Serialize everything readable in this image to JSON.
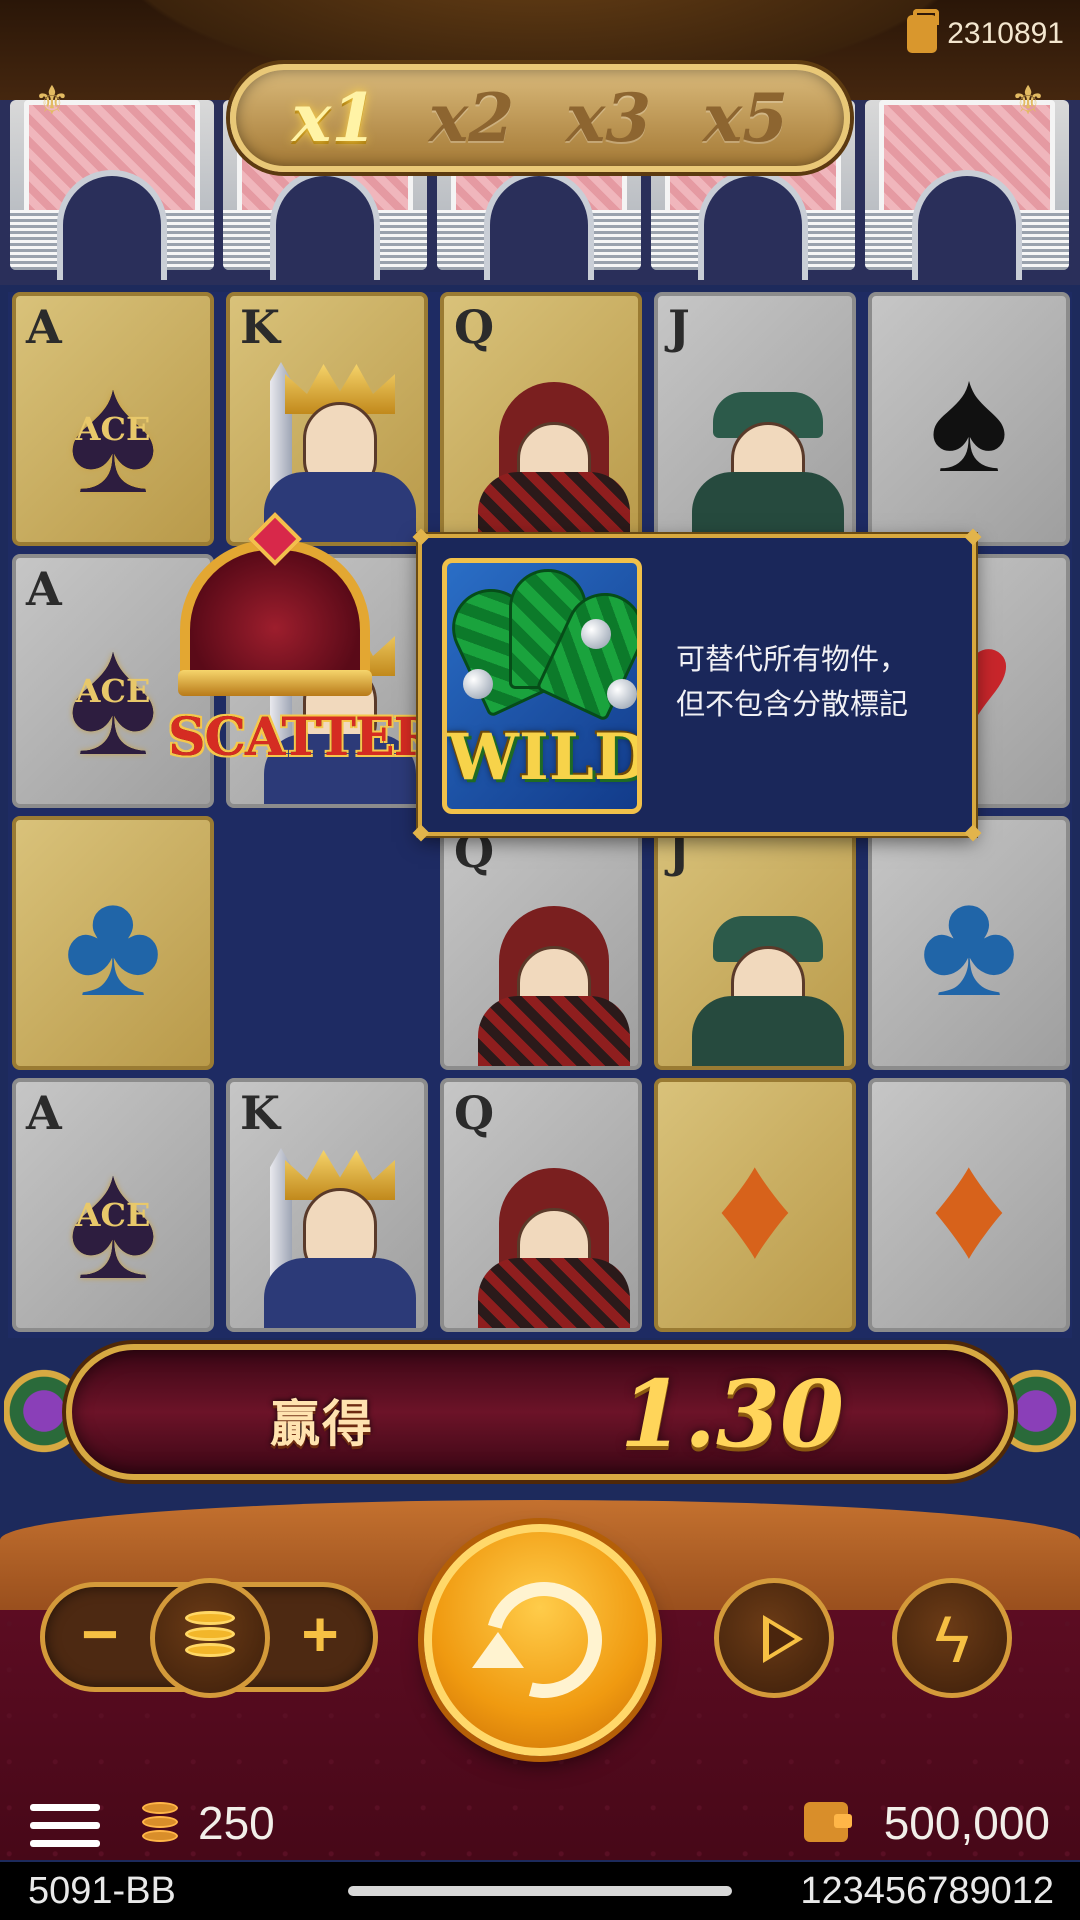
{
  "header": {
    "balance_top": "2310891",
    "multipliers": [
      {
        "label": "x1",
        "active": true
      },
      {
        "label": "x2",
        "active": false
      },
      {
        "label": "x3",
        "active": false
      },
      {
        "label": "x5",
        "active": false
      }
    ]
  },
  "grid": {
    "rows": [
      [
        {
          "rank": "A",
          "style": "gold",
          "symbol": "ace-spade-emblem",
          "emblem_text": "ACE"
        },
        {
          "rank": "K",
          "style": "gold",
          "symbol": "king"
        },
        {
          "rank": "Q",
          "style": "gold",
          "symbol": "queen"
        },
        {
          "rank": "J",
          "style": "silver",
          "symbol": "jack"
        },
        {
          "rank": "",
          "style": "silver",
          "symbol": "spade"
        }
      ],
      [
        {
          "rank": "A",
          "style": "silver",
          "symbol": "ace-spade-emblem",
          "emblem_text": "ACE"
        },
        {
          "rank": "K",
          "style": "silver",
          "symbol": "king"
        },
        {
          "rank": "",
          "style": "silver",
          "symbol": "hidden"
        },
        {
          "rank": "",
          "style": "silver",
          "symbol": "hidden"
        },
        {
          "rank": "",
          "style": "silver",
          "symbol": "heart"
        }
      ],
      [
        {
          "rank": "",
          "style": "gold",
          "symbol": "club"
        },
        {
          "rank": "",
          "style": "scatter",
          "symbol": "scatter"
        },
        {
          "rank": "Q",
          "style": "silver",
          "symbol": "queen"
        },
        {
          "rank": "J",
          "style": "gold",
          "symbol": "jack"
        },
        {
          "rank": "",
          "style": "silver",
          "symbol": "club"
        }
      ],
      [
        {
          "rank": "A",
          "style": "silver",
          "symbol": "ace-spade-emblem",
          "emblem_text": "ACE"
        },
        {
          "rank": "K",
          "style": "silver",
          "symbol": "king"
        },
        {
          "rank": "Q",
          "style": "silver",
          "symbol": "queen"
        },
        {
          "rank": "",
          "style": "gold",
          "symbol": "diamond"
        },
        {
          "rank": "",
          "style": "silver",
          "symbol": "diamond"
        }
      ]
    ],
    "scatter_text": "SCATTER"
  },
  "popup": {
    "symbol_text": "WILD",
    "description_lines": [
      "可替代所有物件，",
      "但不包含分散標記"
    ]
  },
  "win": {
    "label": "贏得",
    "value": "1.30"
  },
  "controls": {
    "minus_label": "−",
    "plus_label": "+"
  },
  "info": {
    "bet_amount": "250",
    "wallet_amount": "500,000",
    "game_code": "5091-BB",
    "round_id": "123456789012"
  },
  "colors": {
    "gold_card": "#d9c27a",
    "silver_card": "#c6c6c6",
    "popup_bg": "#1a275a",
    "win_value": "#ffd55a",
    "spin_button": "#f09a10"
  }
}
